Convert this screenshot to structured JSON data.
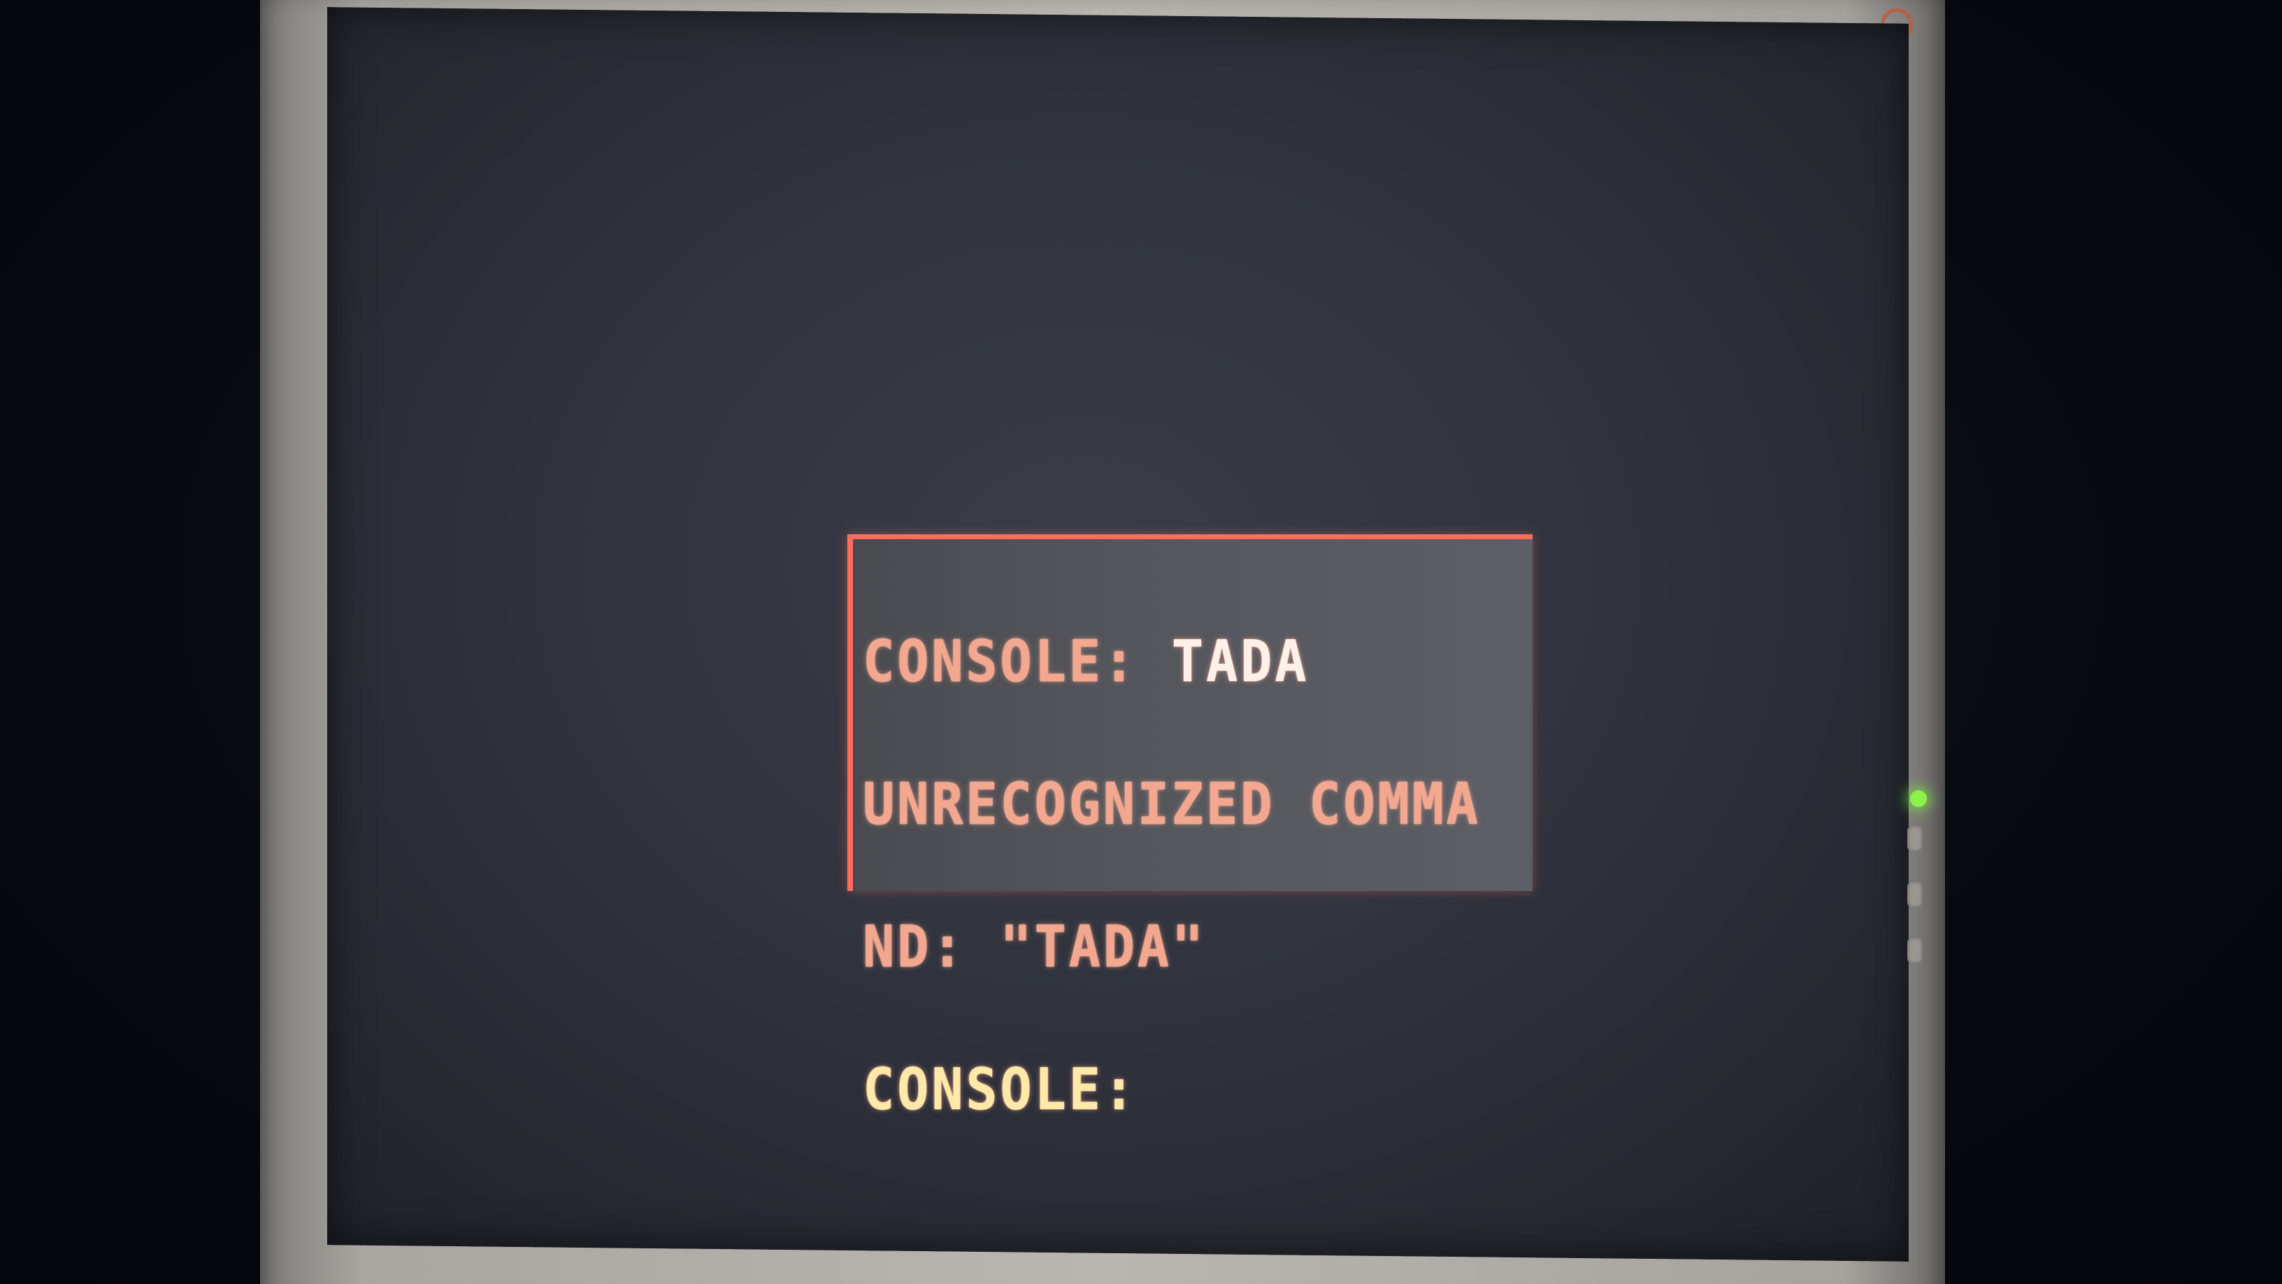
{
  "console": {
    "line1_prompt": "CONSOLE: ",
    "line1_input": "TADA",
    "line2": "UNRECOGNIZED COMMA",
    "line3": "ND: \"TADA\"",
    "line4_prompt": "CONSOLE:"
  },
  "colors": {
    "console_border": "#ff6e5c",
    "console_text": "#f4a78f",
    "power_led": "#8cf24a"
  }
}
